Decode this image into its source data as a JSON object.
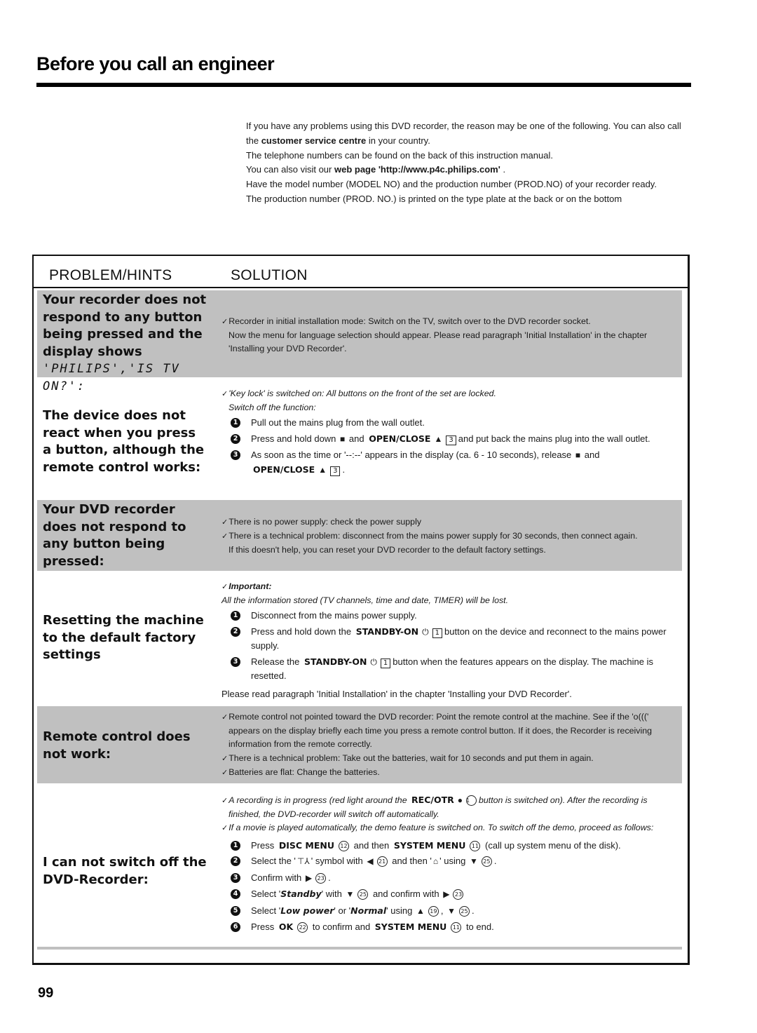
{
  "page": {
    "title": "Before you call an engineer",
    "page_number": "99"
  },
  "intro": {
    "p1_a": "If you have any problems using this DVD recorder, the reason may be one of the following. You can also call the ",
    "p1_b": "customer service centre",
    "p1_c": " in your country.",
    "p2": "The telephone numbers can be found on the back of this instruction manual.",
    "p3_a": "You can also visit our ",
    "p3_b": "web page 'http://www.p4c.philips.com'",
    "p3_c": " .",
    "p4": "Have the model number (MODEL NO) and the production number (PROD.NO) of your recorder ready.",
    "p5": "The production number (PROD. NO.) is printed on the type plate at the back or on the bottom"
  },
  "table": {
    "header_problem": "PROBLEM/HINTS",
    "header_solution": "SOLUTION",
    "check_icon": "✓",
    "rows": [
      {
        "problem": "Your recorder does not respond to any button being pressed and the display shows",
        "problem_display": "'PHILIPS','IS TV ON?':",
        "solution": {
          "l1": "Recorder in initial installation mode: Switch on the TV, switch over to the DVD recorder socket.",
          "l2": "Now the menu for language selection should appear. Please read paragraph 'Initial Installation' in the chapter 'Installing your DVD Recorder'."
        }
      },
      {
        "problem": "The device does not react when you press a button, although the remote control works:",
        "solution": {
          "l1": "'Key lock' is switched on: All buttons on the front of the set are locked.",
          "l2": "Switch off the function:",
          "steps": [
            {
              "n": "1",
              "text": "Pull out the mains plug from the wall outlet."
            },
            {
              "n": "2",
              "a": "Press and hold down",
              "stop": "■",
              "b": "and",
              "key": "OPEN/CLOSE",
              "eject": "▲",
              "box": "3",
              "c": "and put back the mains plug into the wall outlet."
            },
            {
              "n": "3",
              "a": "As soon as the time or '--:--' appears in the display (ca. 6 - 10 seconds), release",
              "stop": "■",
              "b": "and",
              "key": "OPEN/CLOSE",
              "eject": "▲",
              "box": "3",
              "c": "."
            }
          ]
        }
      },
      {
        "problem": "Your DVD recorder does not respond to any button being pressed:",
        "solution": {
          "l1": "There is no power supply: check the power supply",
          "l2": "There is a technical problem: disconnect from the mains power supply for 30 seconds, then connect again.",
          "l3": "If this doesn't help, you can reset your DVD recorder to the default factory settings."
        }
      },
      {
        "problem": "Resetting the machine to the default factory settings",
        "solution": {
          "important": "Important:",
          "l1": "All the information stored (TV channels, time and date, TIMER) will be lost.",
          "steps": [
            {
              "n": "1",
              "text": "Disconnect from the mains power supply."
            },
            {
              "n": "2",
              "a": "Press and hold down the",
              "key": "STANDBY-ON",
              "power": "⏻",
              "box": "1",
              "c": "button on the device and reconnect to the mains power supply."
            },
            {
              "n": "3",
              "a": "Release the",
              "key": "STANDBY-ON",
              "power": "⏻",
              "box": "1",
              "c": "button when the features appears on the display. The machine is resetted."
            }
          ],
          "footer": "Please read paragraph 'Initial Installation' in the chapter 'Installing your DVD Recorder'."
        }
      },
      {
        "problem": "Remote control does not work:",
        "solution": {
          "l1": "Remote control not pointed toward the DVD recorder: Point the remote control at the machine. See if the 'o(((' appears on the display briefly each time you press a remote control button. If it does, the Recorder is receiving information from the remote correctly.",
          "l2": "There is a technical problem: Take out the batteries, wait for 10 seconds and put them in again.",
          "l3": "Batteries are flat: Change the batteries."
        }
      },
      {
        "problem": "I can not switch off the DVD-Recorder:",
        "solution": {
          "l1_a": "A recording is in progress (red light around the",
          "l1_key": "REC/OTR",
          "l1_dot": "●",
          "l1_circ": "1",
          "l1_b": "button is switched on). After the recording is finished, the DVD-recorder will switch off automatically.",
          "l2": "If a movie is played automatically, the demo feature is switched on. To switch off the demo, proceed as follows:",
          "steps": [
            {
              "n": "1",
              "a": "Press",
              "k1": "DISC MENU",
              "c1": "12",
              "b": "and then",
              "k2": "SYSTEM MENU",
              "c2": "11",
              "c": "(call up system menu of the disk)."
            },
            {
              "n": "2",
              "a": "Select the '",
              "sym1": "⊤⅄",
              "b": "' symbol with",
              "arrow1": "◀",
              "c1": "21",
              "c": "and then '",
              "sym2": "⌂",
              "d": "' using",
              "arrow2": "▼",
              "c2": "25",
              "e": "."
            },
            {
              "n": "3",
              "a": "Confirm with",
              "arrow1": "▶",
              "c1": "23",
              "e": "."
            },
            {
              "n": "4",
              "a": "Select '",
              "bi1": "Standby",
              "b": "' with",
              "arrow1": "▼",
              "c1": "25",
              "c": "and confirm with",
              "arrow2": "▶",
              "c2": "23"
            },
            {
              "n": "5",
              "a": "Select '",
              "bi1": "Low power",
              "b": "' or '",
              "bi2": "Normal",
              "c": "' using",
              "arrow1": "▲",
              "c1": "19",
              "d": ",",
              "arrow2": "▼",
              "c2": "25",
              "e": "."
            },
            {
              "n": "6",
              "a": "Press",
              "k1": "OK",
              "c1": "22",
              "b": "to confirm and",
              "k2": "SYSTEM MENU",
              "c2": "11",
              "c": "to end."
            }
          ]
        }
      }
    ]
  }
}
